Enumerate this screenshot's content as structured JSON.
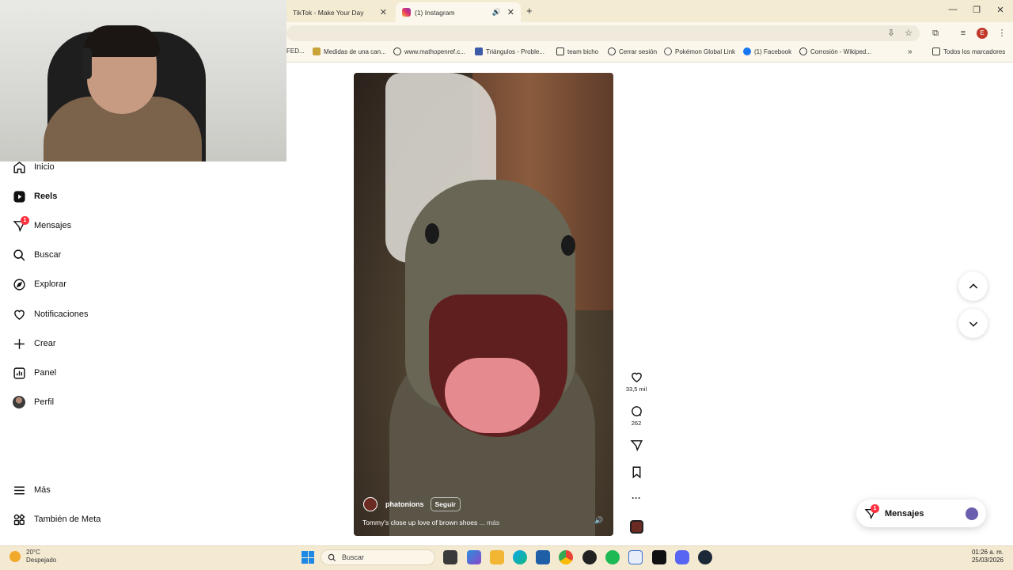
{
  "browser": {
    "tabs": [
      {
        "title": "TikTok - Make Your Day"
      },
      {
        "title": "(1) Instagram"
      }
    ],
    "profile_initial": "E",
    "bookmarks": [
      "FED...",
      "Medidas de una can...",
      "www.mathopenref.c...",
      "Triángulos - Proble...",
      "team bicho",
      "Cerrar sesión",
      "Pokémon Global Link",
      "(1) Facebook",
      "Corrosión - Wikiped..."
    ],
    "bookmarks_folder": "Todos los marcadores",
    "overflow": "»"
  },
  "sidebar": {
    "items": [
      {
        "label": "Inicio",
        "icon": "home-icon"
      },
      {
        "label": "Reels",
        "icon": "reels-icon"
      },
      {
        "label": "Mensajes",
        "icon": "messages-icon",
        "badge": "1"
      },
      {
        "label": "Buscar",
        "icon": "search-icon"
      },
      {
        "label": "Explorar",
        "icon": "compass-icon"
      },
      {
        "label": "Notificaciones",
        "icon": "heart-icon"
      },
      {
        "label": "Crear",
        "icon": "plus-icon"
      },
      {
        "label": "Panel",
        "icon": "dashboard-icon"
      },
      {
        "label": "Perfil",
        "icon": "avatar"
      }
    ],
    "more": "Más",
    "meta": "También de Meta"
  },
  "reel": {
    "author": "phatonions",
    "follow_label": "Seguir",
    "caption": "Tommy's close up love of brown shoes",
    "more_label": "... más",
    "likes": "33,5 mil",
    "comments": "262"
  },
  "messages_pill": {
    "label": "Mensajes",
    "badge": "1"
  },
  "taskbar": {
    "temperature": "20°C",
    "weather": "Despejado",
    "search_placeholder": "Buscar",
    "time": "01:26 a. m.",
    "date": "25/03/2026"
  },
  "colors": {
    "accent_red": "#ff3040",
    "browser_bar": "#f3ebd2"
  }
}
